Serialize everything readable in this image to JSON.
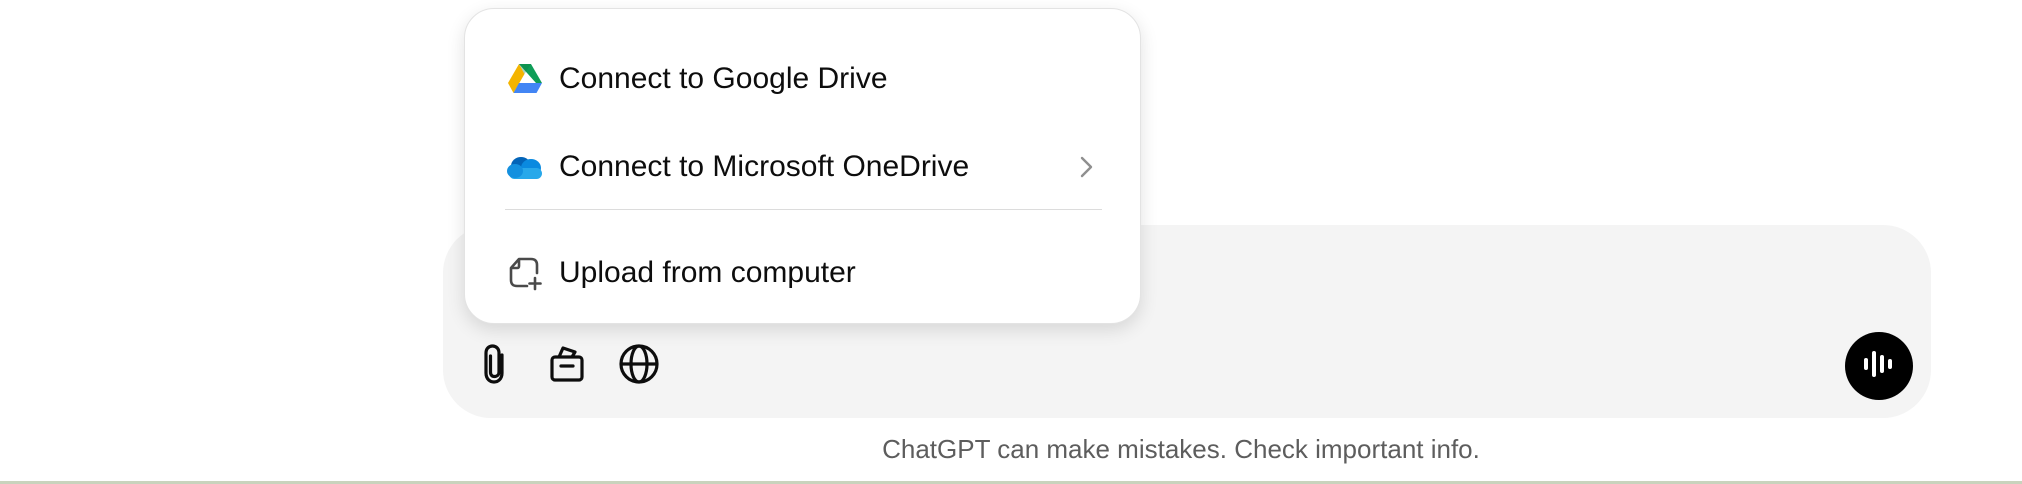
{
  "menu": {
    "items": [
      {
        "label": "Connect to Google Drive",
        "icon": "google-drive-icon",
        "has_submenu": false
      },
      {
        "label": "Connect to Microsoft OneDrive",
        "icon": "onedrive-icon",
        "has_submenu": true
      },
      {
        "label": "Upload from computer",
        "icon": "upload-file-icon",
        "has_submenu": false
      }
    ]
  },
  "composer": {
    "tools": [
      {
        "icon": "paperclip-icon"
      },
      {
        "icon": "toolbox-icon"
      },
      {
        "icon": "globe-icon"
      }
    ],
    "voice_button_icon": "voice-waveform-icon"
  },
  "footer": {
    "disclaimer": "ChatGPT can make mistakes. Check important info."
  },
  "colors": {
    "composer_bg": "#f4f4f4",
    "voice_button_bg": "#000000",
    "disclaimer_text": "#5d5d5d",
    "onedrive_blue": "#0a66c8",
    "drive_green": "#0f9d58",
    "drive_yellow": "#f4b400",
    "drive_blue": "#4285f4"
  }
}
